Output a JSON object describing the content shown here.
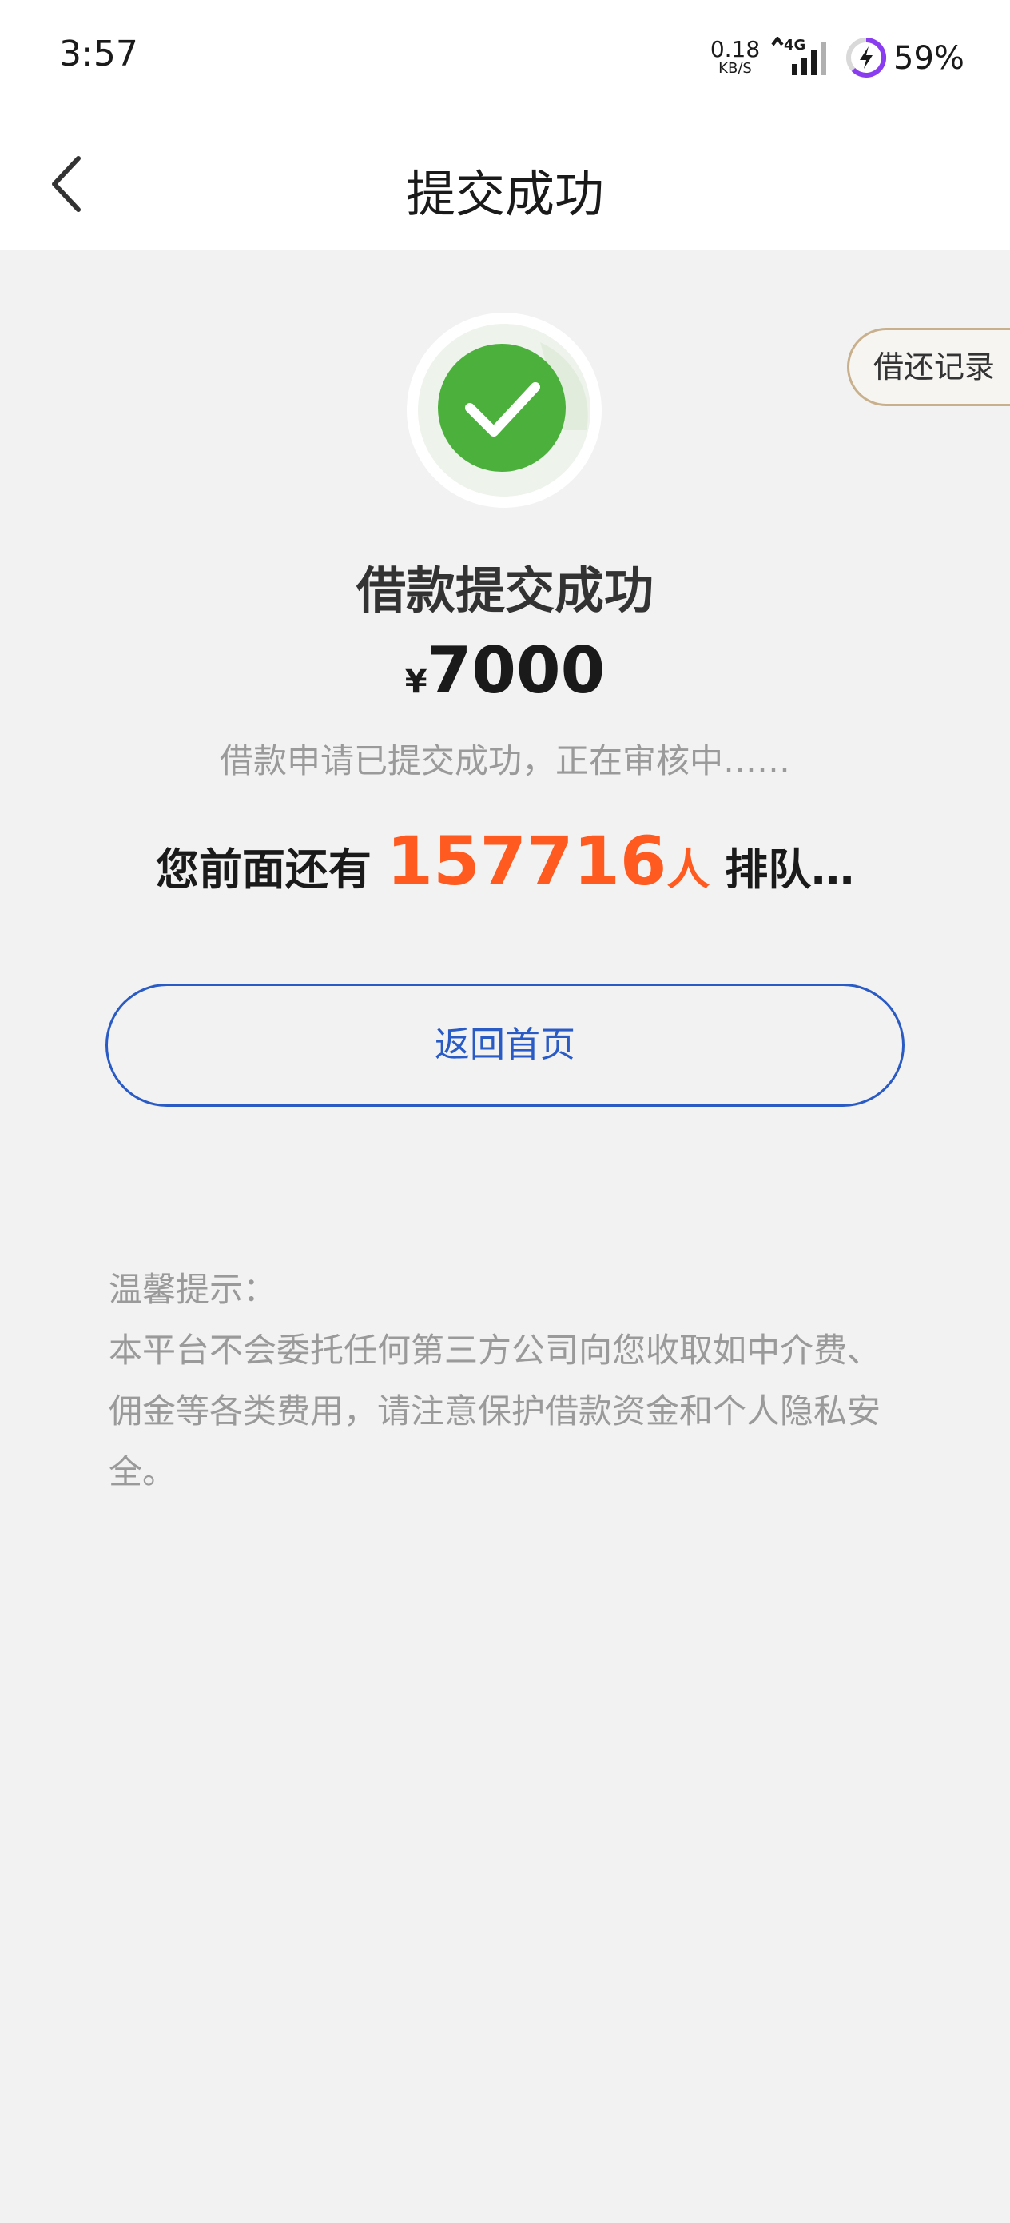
{
  "status_bar": {
    "time": "3:57",
    "net_speed_value": "0.18",
    "net_speed_unit": "KB/S",
    "network": "4G",
    "battery": "59%"
  },
  "header": {
    "title": "提交成功"
  },
  "records_button": "借还记录",
  "result": {
    "title": "借款提交成功",
    "currency": "¥",
    "amount": "7000",
    "status": "借款申请已提交成功，正在审核中……"
  },
  "queue": {
    "prefix": "您前面还有",
    "count": "157716",
    "unit": "人",
    "suffix": "排队…"
  },
  "home_button": "返回首页",
  "tips": {
    "title": "温馨提示：",
    "body": "本平台不会委托任何第三方公司向您收取如中介费、佣金等各类费用，请注意保护借款资金和个人隐私安全。"
  },
  "colors": {
    "success_green": "#4cb03c",
    "accent_blue": "#2a5bc4",
    "count_orange": "#ff5a1f"
  }
}
